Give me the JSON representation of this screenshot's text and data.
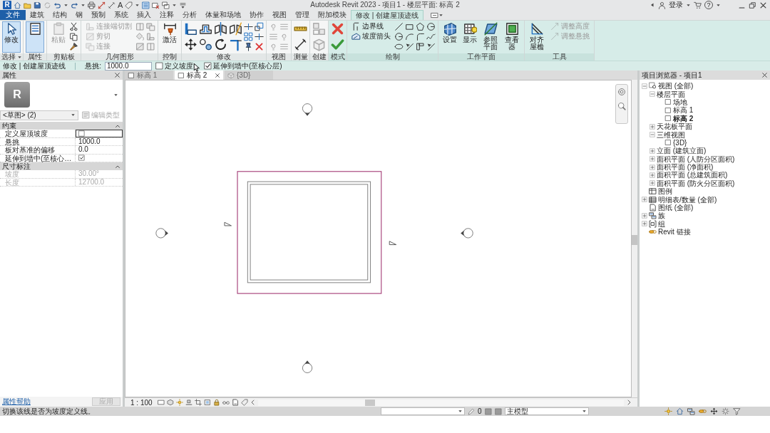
{
  "window": {
    "logo_letter": "R",
    "text_tool": "A",
    "title": "Autodesk Revit 2023 - 项目1 - 楼层平面: 标高 2",
    "sign_in": "登录",
    "help": "?"
  },
  "menu_tabs": [
    {
      "label": "文件",
      "kind": "file",
      "selected": false
    },
    {
      "label": "建筑",
      "kind": "tab",
      "selected": false
    },
    {
      "label": "结构",
      "kind": "tab",
      "selected": false
    },
    {
      "label": "钢",
      "kind": "tab",
      "selected": false
    },
    {
      "label": "预制",
      "kind": "tab",
      "selected": false
    },
    {
      "label": "系统",
      "kind": "tab",
      "selected": false
    },
    {
      "label": "插入",
      "kind": "tab",
      "selected": false
    },
    {
      "label": "注释",
      "kind": "tab",
      "selected": false
    },
    {
      "label": "分析",
      "kind": "tab",
      "selected": false
    },
    {
      "label": "体量和场地",
      "kind": "tab",
      "selected": false
    },
    {
      "label": "协作",
      "kind": "tab",
      "selected": false
    },
    {
      "label": "视图",
      "kind": "tab",
      "selected": false
    },
    {
      "label": "管理",
      "kind": "tab",
      "selected": false
    },
    {
      "label": "附加模块",
      "kind": "tab",
      "selected": false
    },
    {
      "label": "修改 | 创建屋顶迹线",
      "kind": "tab",
      "selected": true
    }
  ],
  "ribbon_panels": [
    {
      "label": "选择",
      "contextual": false,
      "dropdown": true,
      "tools": [
        {
          "kind": "large",
          "label": "修改",
          "selected": true,
          "disabled": false
        }
      ]
    },
    {
      "label": "属性",
      "contextual": false,
      "dropdown": false,
      "tools": [
        {
          "kind": "large",
          "selected": true,
          "disabled": false
        }
      ]
    },
    {
      "label": "剪贴板",
      "contextual": false,
      "dropdown": false,
      "tools": [
        {
          "kind": "large",
          "label": "粘贴",
          "selected": false,
          "disabled": true
        }
      ]
    },
    {
      "label": "几何图形",
      "contextual": false,
      "dropdown": false,
      "tools": [
        {
          "kind": "small",
          "label": "连接端切割",
          "selected": false,
          "disabled": true
        },
        {
          "kind": "small",
          "label": "剪切",
          "selected": false,
          "disabled": true
        },
        {
          "kind": "small",
          "label": "连接",
          "selected": false,
          "disabled": true
        }
      ]
    },
    {
      "label": "控制",
      "contextual": false,
      "dropdown": false,
      "tools": [
        {
          "kind": "large",
          "label": "激活",
          "selected": false,
          "disabled": false
        }
      ]
    },
    {
      "label": "修改",
      "contextual": false,
      "dropdown": false
    },
    {
      "label": "视图",
      "contextual": false,
      "dropdown": false
    },
    {
      "label": "测量",
      "contextual": false,
      "dropdown": false
    },
    {
      "label": "创建",
      "contextual": false,
      "dropdown": false
    },
    {
      "label": "模式",
      "contextual": true,
      "dropdown": false
    },
    {
      "label": "绘制",
      "contextual": true,
      "dropdown": false,
      "tools": [
        {
          "kind": "small",
          "label": "边界线",
          "selected": false,
          "disabled": false
        },
        {
          "kind": "small",
          "label": "坡度箭头",
          "selected": false,
          "disabled": false
        }
      ]
    },
    {
      "label": "工作平面",
      "contextual": true,
      "dropdown": false,
      "tools": [
        {
          "kind": "large",
          "label": "设置",
          "selected": false,
          "disabled": false
        },
        {
          "kind": "large",
          "label": "显示",
          "selected": false,
          "disabled": false
        },
        {
          "kind": "large",
          "label": "参照平面",
          "selected": false,
          "disabled": false
        },
        {
          "kind": "large",
          "label": "查看器",
          "selected": false,
          "disabled": false
        }
      ]
    },
    {
      "label": "工具",
      "contextual": true,
      "dropdown": false,
      "tools": [
        {
          "kind": "large",
          "label": "对齐屋檐",
          "selected": false,
          "disabled": false
        },
        {
          "kind": "small",
          "label": "调整高度",
          "selected": false,
          "disabled": true
        },
        {
          "kind": "small",
          "label": "调整悬挑",
          "selected": false,
          "disabled": true
        }
      ]
    }
  ],
  "options_bar": {
    "mode": "修改 | 创建屋顶迹线",
    "overhang_label": "悬挑:",
    "overhang_value": "1000.0",
    "checkboxes": [
      {
        "label": "定义坡度",
        "checked": false
      },
      {
        "label": "延伸到墙中(至核心层)",
        "checked": true
      }
    ]
  },
  "properties": {
    "title": "属性",
    "preview_letter": "R",
    "type_selector": "<草图> (2)",
    "edit_type": {
      "label": "编辑类型",
      "disabled": true
    },
    "groups": [
      {
        "name": "约束",
        "expanded": true,
        "rows": [
          {
            "name": "定义屋顶坡度",
            "kind": "checkbox",
            "checked": false,
            "selected": true,
            "disabled": false
          },
          {
            "name": "悬挑",
            "kind": "text",
            "value": "1000.0",
            "selected": false,
            "disabled": false
          },
          {
            "name": "板对基准的偏移",
            "kind": "text",
            "value": "0.0",
            "selected": false,
            "disabled": false
          },
          {
            "name": "延伸到墙中(至核心…",
            "kind": "checkbox",
            "checked": true,
            "selected": false,
            "disabled": false
          }
        ]
      },
      {
        "name": "尺寸标注",
        "expanded": true,
        "rows": [
          {
            "name": "坡度",
            "kind": "text",
            "value": "30.00°",
            "selected": false,
            "disabled": true
          },
          {
            "name": "长度",
            "kind": "text",
            "value": "12700.0",
            "selected": false,
            "disabled": true
          }
        ]
      }
    ],
    "help_link": "属性帮助",
    "apply": {
      "label": "应用",
      "disabled": true
    }
  },
  "view_tabs": [
    {
      "label": "标高 1",
      "kind": "plan",
      "selected": false
    },
    {
      "label": "标高 2",
      "kind": "plan",
      "selected": true
    },
    {
      "label": "{3D}",
      "kind": "model",
      "selected": false
    }
  ],
  "project_browser": {
    "title": "项目浏览器 - 项目1",
    "tree": [
      {
        "label": "视图 (全部)",
        "expanded": true,
        "selected": false,
        "children": [
          {
            "label": "楼层平面",
            "expanded": true,
            "selected": false,
            "children": [
              {
                "label": "场地",
                "selected": false
              },
              {
                "label": "标高 1",
                "selected": false
              },
              {
                "label": "标高 2",
                "selected": true
              }
            ]
          },
          {
            "label": "天花板平面",
            "expanded": false,
            "selected": false
          },
          {
            "label": "三维视图",
            "expanded": true,
            "selected": false,
            "children": [
              {
                "label": "{3D}",
                "selected": false
              }
            ]
          },
          {
            "label": "立面 (建筑立面)",
            "expanded": false,
            "selected": false
          },
          {
            "label": "面积平面 (人防分区面积)",
            "expanded": false,
            "selected": false
          },
          {
            "label": "面积平面 (净面积)",
            "expanded": false,
            "selected": false
          },
          {
            "label": "面积平面 (总建筑面积)",
            "expanded": false,
            "selected": false
          },
          {
            "label": "面积平面 (防火分区面积)",
            "expanded": false,
            "selected": false
          }
        ]
      },
      {
        "label": "图例",
        "selected": false
      },
      {
        "label": "明细表/数量 (全部)",
        "expanded": false,
        "selected": false
      },
      {
        "label": "图纸 (全部)",
        "selected": false
      },
      {
        "label": "族",
        "expanded": false,
        "selected": false
      },
      {
        "label": "组",
        "expanded": false,
        "selected": false
      },
      {
        "label": "Revit 链接",
        "selected": false
      }
    ]
  },
  "view_control_bar": {
    "scale": "1 : 100"
  },
  "status_bar": {
    "message": "切换该线是否为坡度定义线。",
    "editable_count": "0",
    "model": "主模型"
  }
}
